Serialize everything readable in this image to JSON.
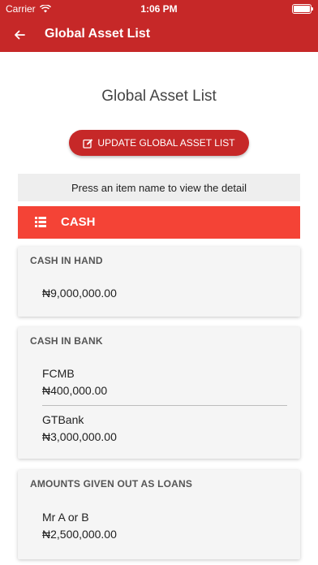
{
  "status": {
    "carrier": "Carrier",
    "time": "1:06 PM"
  },
  "header": {
    "title": "Global Asset List"
  },
  "main": {
    "title": "Global Asset List",
    "update_button_label": "UPDATE GLOBAL ASSET LIST",
    "hint": "Press an item name to view the detail",
    "category": "CASH"
  },
  "sections": [
    {
      "title": "CASH IN HAND",
      "items": [
        {
          "name": "",
          "value": "₦9,000,000.00"
        }
      ]
    },
    {
      "title": "CASH IN BANK",
      "items": [
        {
          "name": "FCMB",
          "value": "₦400,000.00"
        },
        {
          "name": "GTBank",
          "value": "₦3,000,000.00"
        }
      ]
    },
    {
      "title": "AMOUNTS GIVEN OUT AS LOANS",
      "items": [
        {
          "name": "Mr A or B",
          "value": "₦2,500,000.00"
        }
      ]
    }
  ],
  "colors": {
    "primary": "#c62828",
    "accent": "#f44336",
    "card_bg": "#f5f5f5",
    "hint_bg": "#eeeeee"
  }
}
